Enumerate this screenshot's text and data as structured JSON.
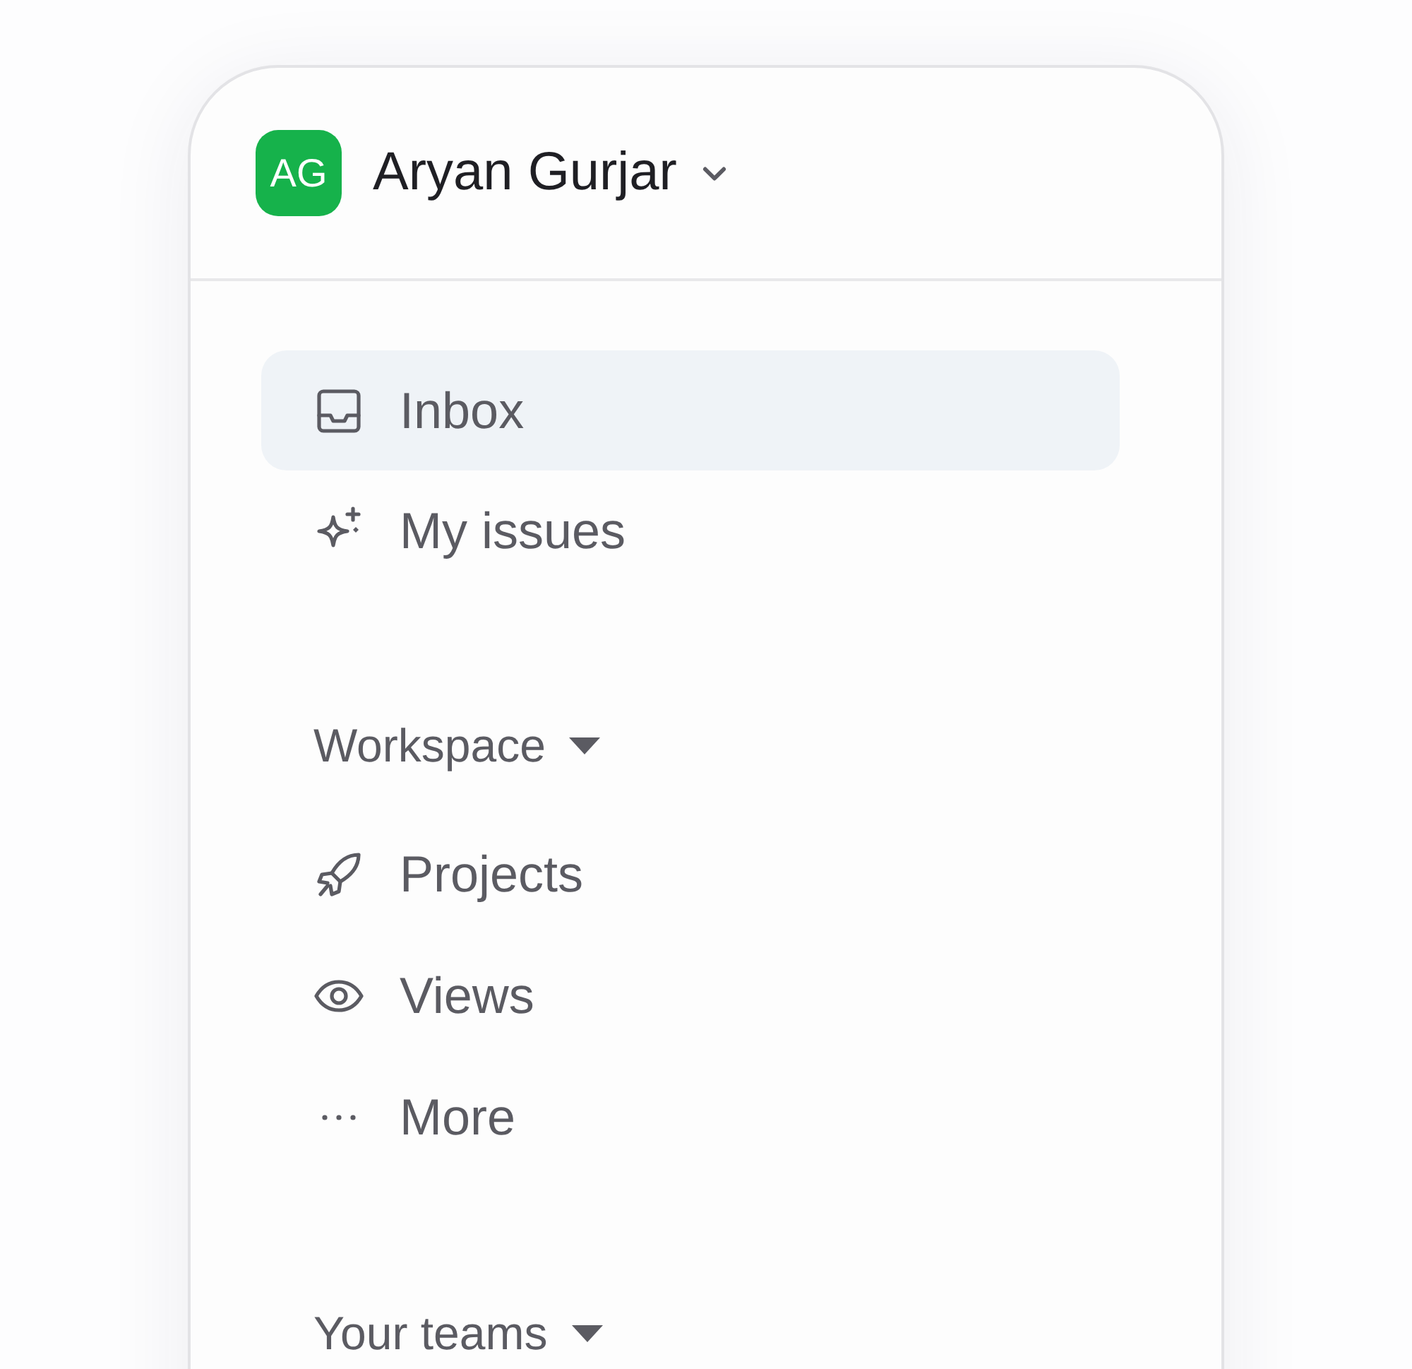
{
  "account": {
    "initials": "AG",
    "name": "Aryan Gurjar"
  },
  "nav": [
    {
      "label": "Inbox",
      "kind": "inbox",
      "selected": true
    },
    {
      "label": "My issues",
      "kind": "sparkle",
      "selected": false
    }
  ],
  "sections": [
    {
      "title": "Workspace",
      "items": [
        {
          "label": "Projects",
          "kind": "rocket",
          "selected": false
        },
        {
          "label": "Views",
          "kind": "eye",
          "selected": false
        },
        {
          "label": "More",
          "kind": "dots",
          "selected": false
        }
      ]
    },
    {
      "title": "Your teams"
    }
  ]
}
